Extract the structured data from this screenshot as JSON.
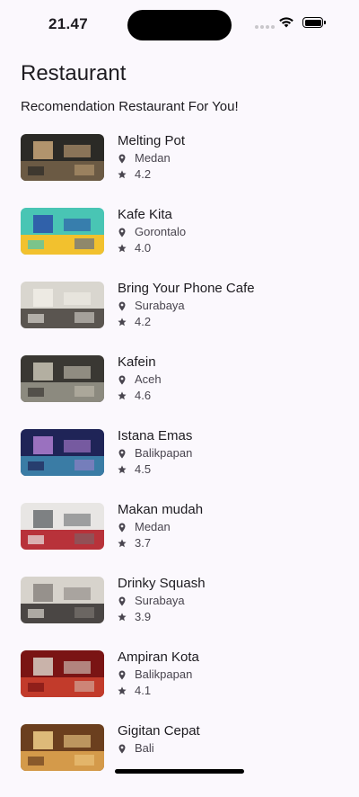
{
  "status_bar": {
    "time": "21.47"
  },
  "header": {
    "title": "Restaurant",
    "subtitle": "Recomendation Restaurant For You!"
  },
  "restaurants": [
    {
      "name": "Melting Pot",
      "city": "Medan",
      "rating": "4.2",
      "thumb_colors": [
        "#2b2a26",
        "#6b5a44",
        "#c9a77a"
      ]
    },
    {
      "name": "Kafe Kita",
      "city": "Gorontalo",
      "rating": "4.0",
      "thumb_colors": [
        "#49c5b4",
        "#f2c12e",
        "#2b4fa8"
      ]
    },
    {
      "name": "Bring Your Phone Cafe",
      "city": "Surabaya",
      "rating": "4.2",
      "thumb_colors": [
        "#d9d6cf",
        "#5a5550",
        "#f0ede6"
      ]
    },
    {
      "name": "Kafein",
      "city": "Aceh",
      "rating": "4.6",
      "thumb_colors": [
        "#3a3833",
        "#8c8a7f",
        "#c9c4b5"
      ]
    },
    {
      "name": "Istana Emas",
      "city": "Balikpapan",
      "rating": "4.5",
      "thumb_colors": [
        "#1f2457",
        "#3a7ca5",
        "#b07fd1"
      ]
    },
    {
      "name": "Makan mudah",
      "city": "Medan",
      "rating": "3.7",
      "thumb_colors": [
        "#e8e6e4",
        "#b8323a",
        "#6b6e72"
      ]
    },
    {
      "name": "Drinky Squash",
      "city": "Surabaya",
      "rating": "3.9",
      "thumb_colors": [
        "#d7d3cc",
        "#4a4644",
        "#8b8580"
      ]
    },
    {
      "name": "Ampiran Kota",
      "city": "Balikpapan",
      "rating": "4.1",
      "thumb_colors": [
        "#7a1414",
        "#c23b2b",
        "#d7cfc4"
      ]
    },
    {
      "name": "Gigitan Cepat",
      "city": "Bali",
      "rating": "",
      "thumb_colors": [
        "#6b3f1e",
        "#d49a4a",
        "#f1d08a"
      ]
    }
  ],
  "icons": {
    "location": "location-pin-icon",
    "rating": "star-icon"
  }
}
